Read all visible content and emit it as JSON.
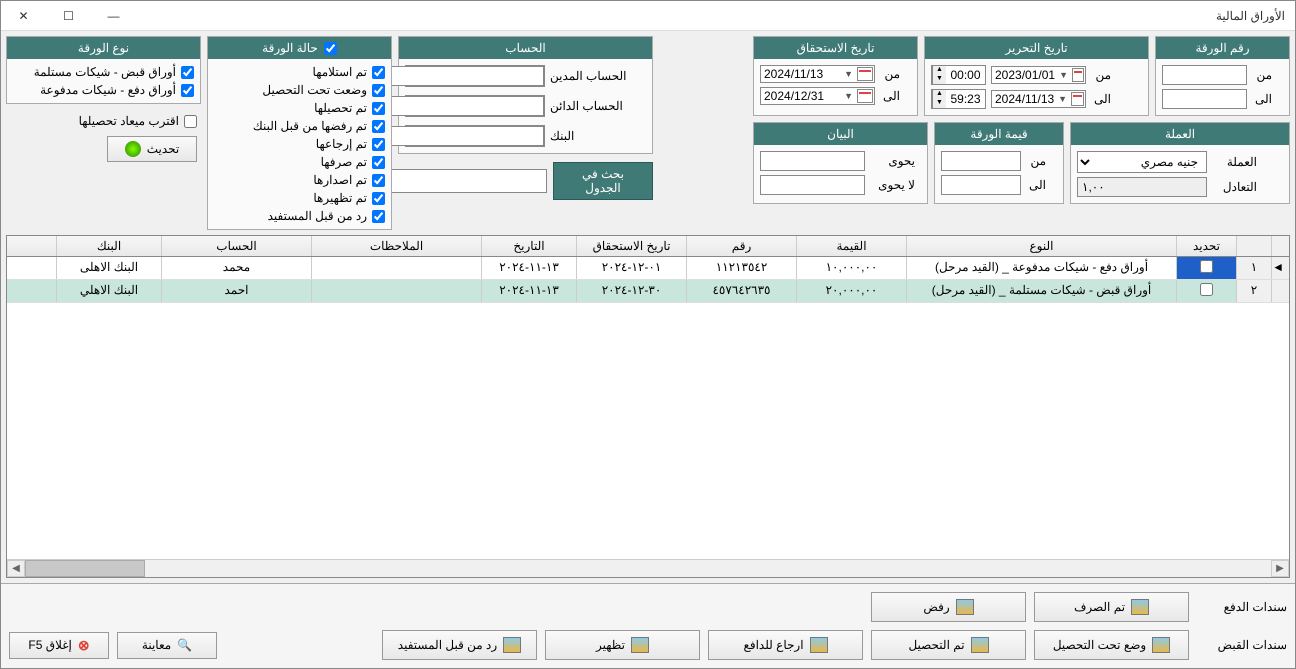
{
  "window": {
    "title": "الأوراق المالية"
  },
  "paperType": {
    "header": "نوع الورقة",
    "items": [
      {
        "label": "أوراق قبض - شيكات مستلمة",
        "checked": true
      },
      {
        "label": "أوراق دفع - شيكات مدفوعة",
        "checked": true
      }
    ]
  },
  "paperStatus": {
    "header": "حالة الورقة",
    "items": [
      {
        "label": "تم استلامها",
        "checked": true
      },
      {
        "label": "وضعت تحت التحصيل",
        "checked": true
      },
      {
        "label": "تم تحصيلها",
        "checked": true
      },
      {
        "label": "تم رفضها من قبل البنك",
        "checked": true
      },
      {
        "label": "تم إرجاعها",
        "checked": true
      },
      {
        "label": "تم صرفها",
        "checked": true
      },
      {
        "label": "تم اصدارها",
        "checked": true
      },
      {
        "label": "تم تظهيرها",
        "checked": true
      },
      {
        "label": "رد من قبل المستفيد",
        "checked": true
      }
    ]
  },
  "nearCollection": {
    "label": "اقترب ميعاد تحصيلها",
    "checked": false
  },
  "refreshBtn": "تحديث",
  "account": {
    "header": "الحساب",
    "debit": "الحساب المدين",
    "credit": "الحساب الدائن",
    "bank": "البنك"
  },
  "searchBtn": "بحث في الجدول",
  "dueDate": {
    "header": "تاريخ الاستحقاق",
    "fromLabel": "من",
    "fromValue": "2024/11/13",
    "toLabel": "الى",
    "toValue": "2024/12/31"
  },
  "writeDate": {
    "header": "تاريخ التحرير",
    "fromLabel": "من",
    "fromValue": "2023/01/01",
    "fromTime": "00:00",
    "toLabel": "الى",
    "toValue": "2024/11/13",
    "toTime": "59:23"
  },
  "paperNo": {
    "header": "رقم الورقة",
    "fromLabel": "من",
    "toLabel": "الى"
  },
  "currency": {
    "header": "العملة",
    "label": "العملة",
    "value": "جنيه مصري",
    "rateLabel": "التعادل",
    "rateValue": "١,٠٠"
  },
  "paperValue": {
    "header": "قيمة الورقة",
    "fromLabel": "من",
    "toLabel": "الى"
  },
  "statement": {
    "header": "البيان",
    "containsLabel": "يحوى",
    "notContainsLabel": "لا يحوى"
  },
  "grid": {
    "headers": {
      "select": "تحديد",
      "type": "النوع",
      "value": "القيمة",
      "number": "رقم",
      "due": "تاريخ الاستحقاق",
      "date": "التاريخ",
      "notes": "الملاحظات",
      "account": "الحساب",
      "bank": "البنك"
    },
    "rows": [
      {
        "n": "١",
        "type": "أوراق دفع - شيكات مدفوعة _  (القيد مرحل)",
        "value": "١٠,٠٠٠,٠٠",
        "number": "١١٢١٣٥٤٢",
        "due": "٠١-١٢-٢٠٢٤",
        "date": "١٣-١١-٢٠٢٤",
        "notes": "",
        "account": "محمد",
        "bank": "البنك الاهلى"
      },
      {
        "n": "٢",
        "type": "أوراق قبض - شيكات مستلمة _  (القيد مرحل)",
        "value": "٢٠,٠٠٠,٠٠",
        "number": "٤٥٧٦٤٢٦٣٥",
        "due": "٣٠-١٢-٢٠٢٤",
        "date": "١٣-١١-٢٠٢٤",
        "notes": "",
        "account": "احمد",
        "bank": "البنك الاهلي"
      }
    ]
  },
  "footer": {
    "payLabel": "سندات الدفع",
    "receiveLabel": "سندات القبض",
    "pay": {
      "disbursed": "تم الصرف",
      "reject": "رفض"
    },
    "receive": {
      "underCollection": "وضع تحت التحصيل",
      "collected": "تم التحصيل",
      "returnPayer": "ارجاع للدافع",
      "endorse": "تظهير",
      "returnBenef": "رد من قبل المستفيد"
    },
    "preview": "معاينة",
    "close": "إغلاق  F5"
  }
}
